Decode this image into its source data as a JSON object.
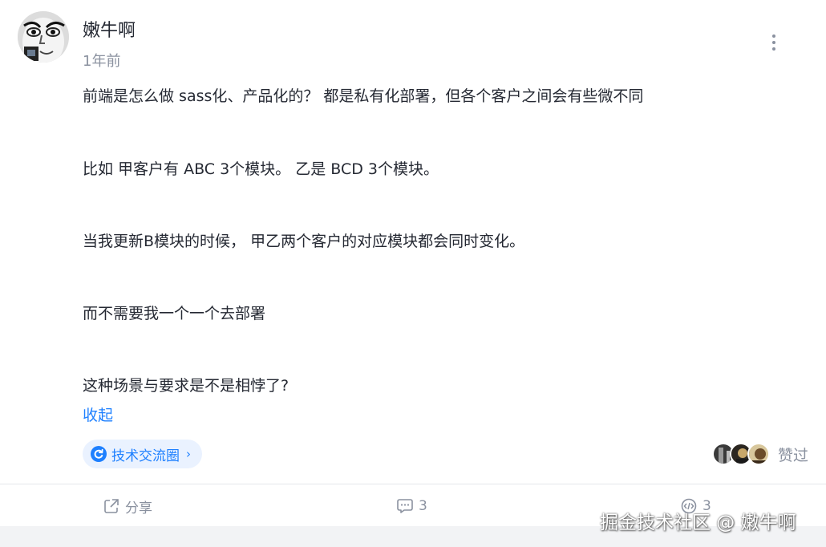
{
  "author": {
    "name": "嫩牛啊",
    "time": "1年前",
    "avatar_icon": "meme-face-avatar"
  },
  "content": {
    "paragraphs": [
      "前端是怎么做 sass化、产品化的？ 都是私有化部署，但各个客户之间会有些微不同",
      "比如 甲客户有 ABC 3个模块。 乙是 BCD 3个模块。",
      "当我更新B模块的时候， 甲乙两个客户的对应模块都会同时变化。",
      "而不需要我一个一个去部署",
      "这种场景与要求是不是相悖了?"
    ],
    "collapse_label": "收起"
  },
  "topic": {
    "label": "技术交流圈",
    "chevron": "›",
    "icon": "circle-refresh-icon"
  },
  "likes": {
    "label": "赞过",
    "avatar_count": 3
  },
  "actions": {
    "share_label": "分享",
    "comment_count": "3",
    "code_count": "3"
  },
  "watermark": "掘金技术社区 @ 嫩牛啊",
  "colors": {
    "accent": "#1e80ff",
    "text": "#252933",
    "muted": "#8a919f",
    "tag_bg": "#eaf2ff"
  }
}
